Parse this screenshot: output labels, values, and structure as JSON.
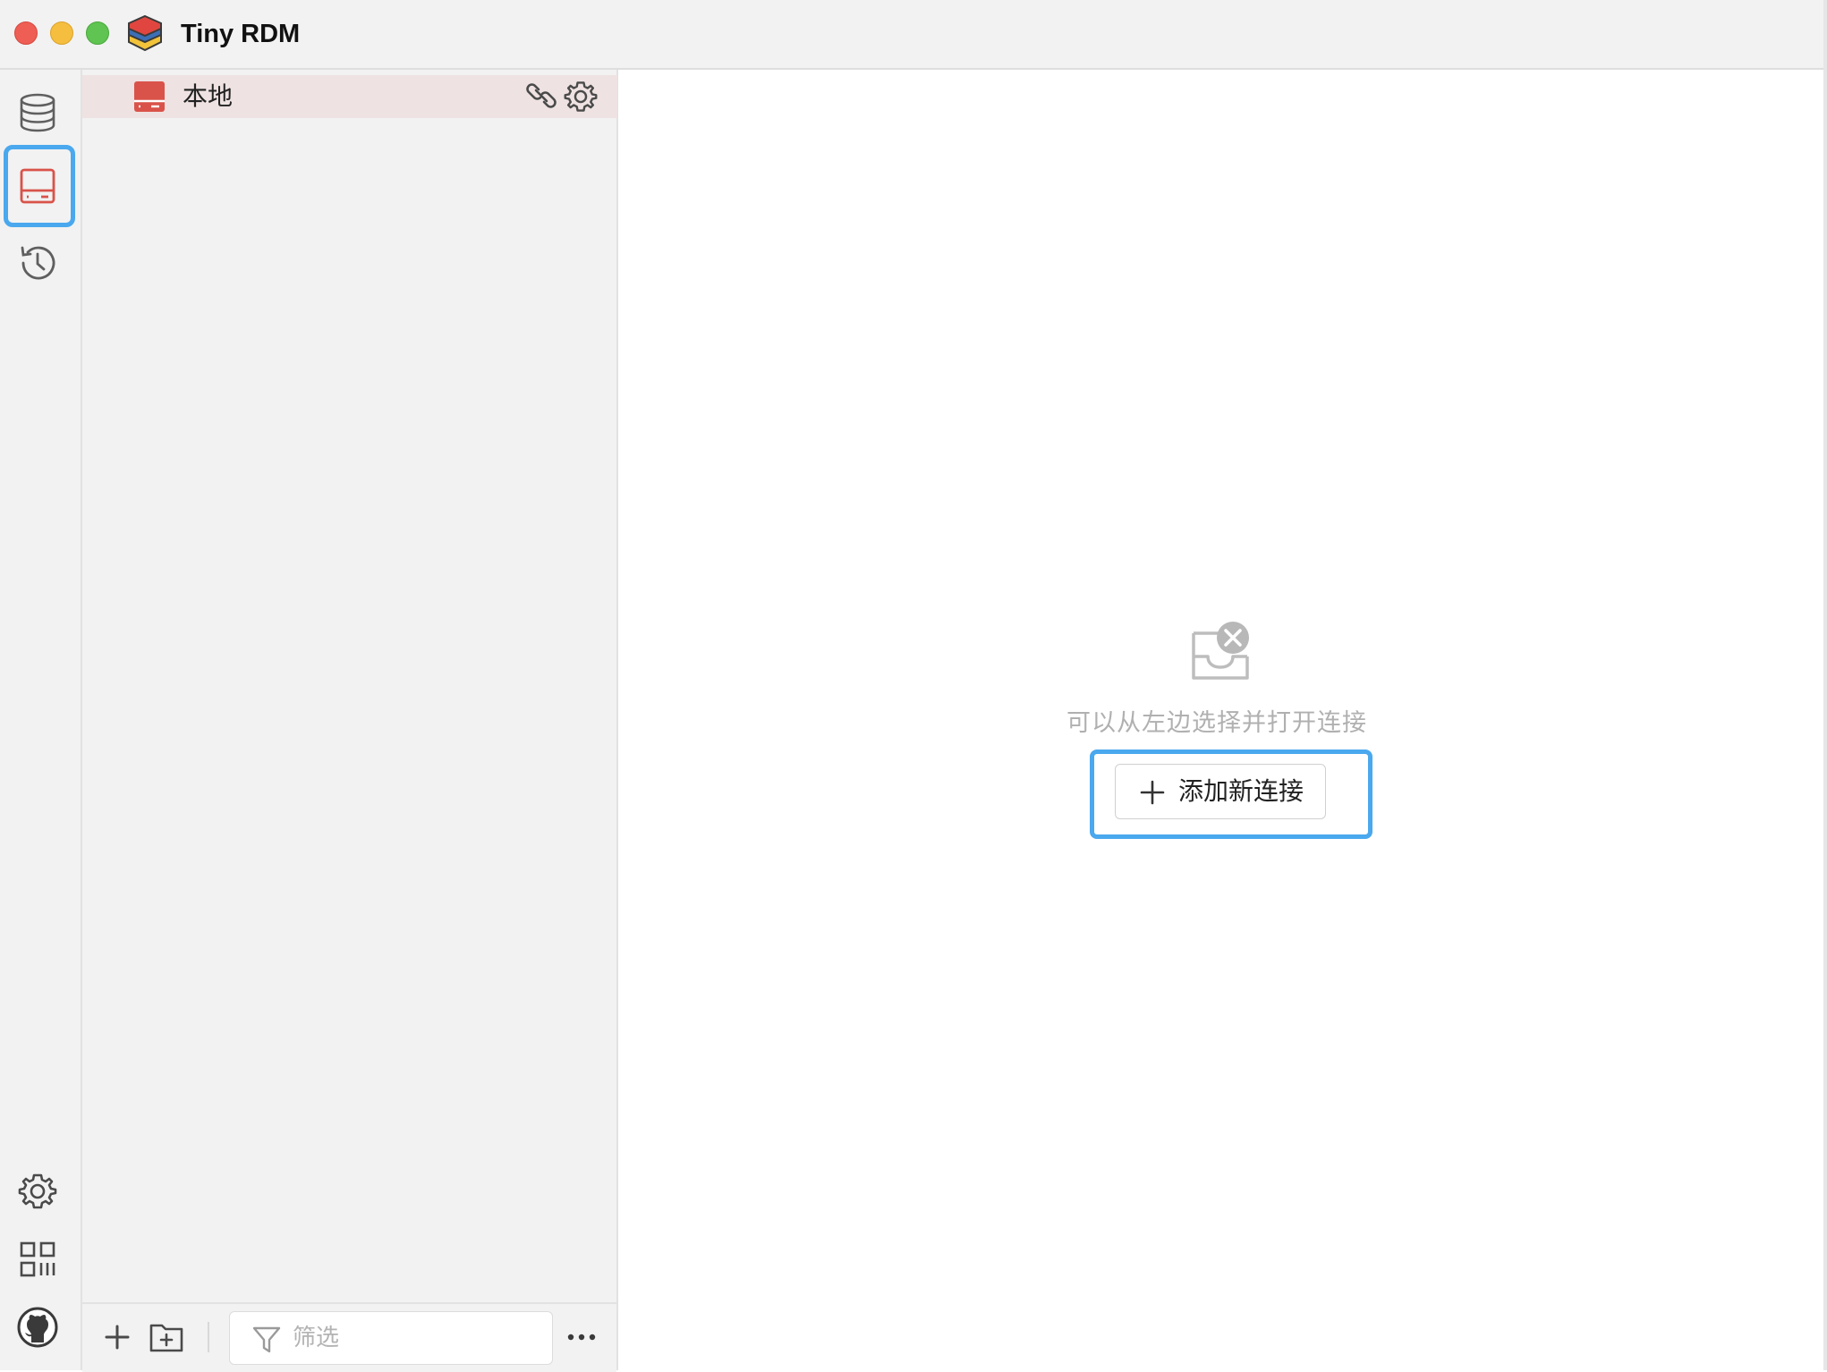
{
  "window": {
    "title": "Tiny RDM"
  },
  "nav": {
    "items": [
      {
        "icon": "database-icon",
        "selected": false
      },
      {
        "icon": "server-icon",
        "selected": true
      },
      {
        "icon": "history-icon",
        "selected": false
      }
    ],
    "bottom_items": [
      {
        "icon": "gear-icon"
      },
      {
        "icon": "apps-grid-icon"
      },
      {
        "icon": "github-icon"
      }
    ]
  },
  "connections": {
    "items": [
      {
        "label": "本地",
        "icon": "server-icon",
        "color": "#d9534a"
      }
    ],
    "filter_placeholder": "筛选"
  },
  "main": {
    "empty_message": "可以从左边选择并打开连接",
    "add_connection_label": "添加新连接"
  },
  "colors": {
    "accent": "#4aa8ee",
    "brand_red": "#d9534a",
    "selected_row": "#efe2e2"
  }
}
